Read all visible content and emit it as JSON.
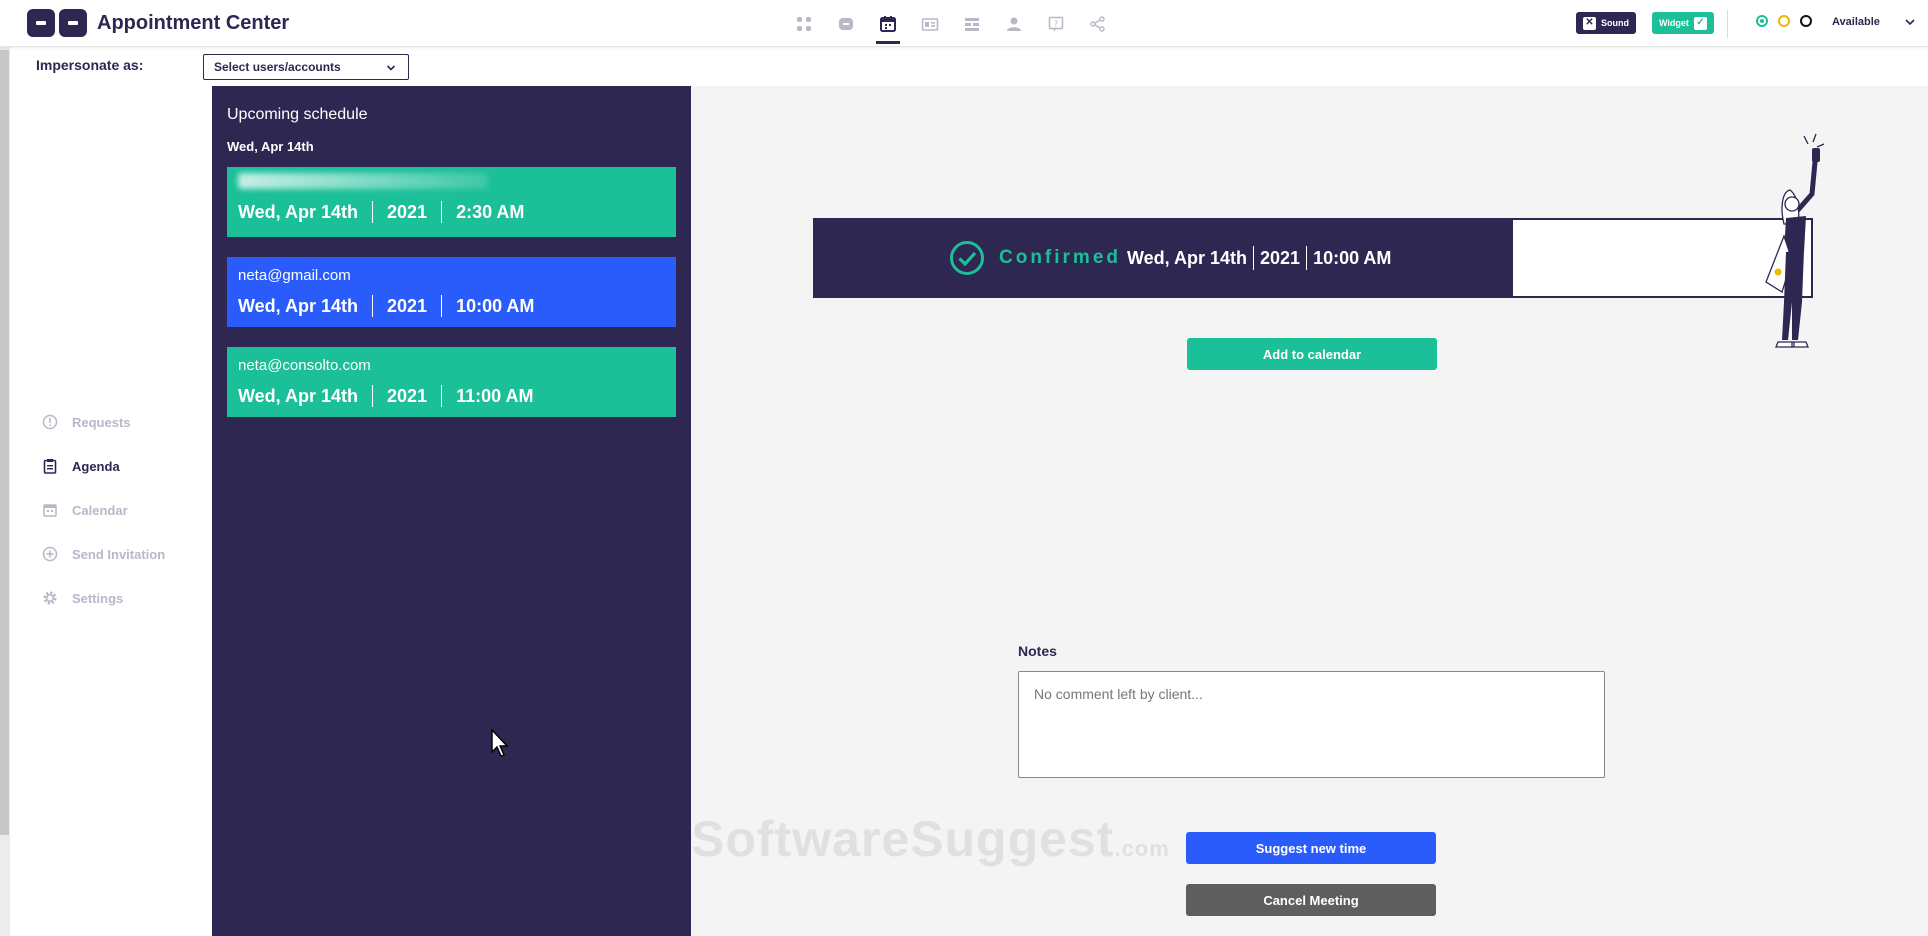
{
  "header": {
    "app_title": "Appointment Center",
    "nav_icons": [
      "dashboard-icon",
      "chat-icon",
      "calendar-icon",
      "id-card-icon",
      "list-icon",
      "person-icon",
      "help-icon",
      "share-icon"
    ],
    "active_nav": "calendar-icon",
    "sound_label": "Sound",
    "widget_label": "Widget",
    "status": "Available"
  },
  "impersonate": {
    "label": "Impersonate as:",
    "select_value": "Select users/accounts"
  },
  "sidebar": {
    "items": [
      {
        "label": "Requests",
        "icon": "alert-circle-icon",
        "active": false
      },
      {
        "label": "Agenda",
        "icon": "clipboard-icon",
        "active": true
      },
      {
        "label": "Calendar",
        "icon": "calendar-icon",
        "active": false
      },
      {
        "label": "Send Invitation",
        "icon": "plus-circle-icon",
        "active": false
      },
      {
        "label": "Settings",
        "icon": "gear-icon",
        "active": false
      }
    ]
  },
  "schedule": {
    "title": "Upcoming schedule",
    "date_heading": "Wed, Apr 14th",
    "appointments": [
      {
        "who": "",
        "date": "Wed, Apr 14th",
        "year": "2021",
        "time": "2:30 AM",
        "color": "#1bbf98"
      },
      {
        "who": "neta@gmail.com",
        "date": "Wed, Apr 14th",
        "year": "2021",
        "time": "10:00 AM",
        "color": "#2a5cfc"
      },
      {
        "who": "neta@consolto.com",
        "date": "Wed, Apr 14th",
        "year": "2021",
        "time": "11:00 AM",
        "color": "#1bbf98"
      }
    ]
  },
  "details": {
    "status_label": "Confirmed",
    "date": "Wed, Apr 14th",
    "year": "2021",
    "time": "10:00 AM",
    "add_calendar_label": "Add to calendar",
    "notes_label": "Notes",
    "notes_text": "No comment left by client...",
    "suggest_label": "Suggest new time",
    "cancel_label": "Cancel Meeting"
  },
  "watermark": {
    "text": "SoftwareSuggest",
    "suffix": ".com"
  },
  "colors": {
    "navy": "#2d2752",
    "green": "#1bbf98",
    "blue": "#2a5cfc",
    "gray_button": "#5e5e5e"
  }
}
